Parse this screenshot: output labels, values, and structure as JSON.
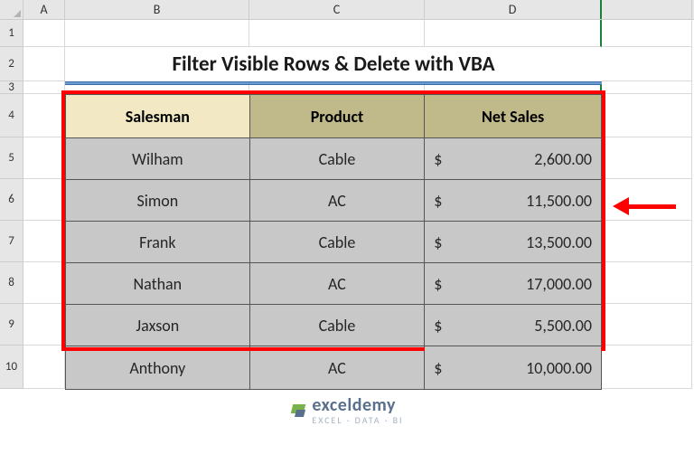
{
  "columns": {
    "A": "A",
    "B": "B",
    "C": "C",
    "D": "D"
  },
  "rows": [
    "1",
    "2",
    "3",
    "4",
    "5",
    "6",
    "7",
    "8",
    "9",
    "10"
  ],
  "title": "Filter Visible Rows & Delete with VBA",
  "chart_data": {
    "type": "table",
    "headers": [
      "Salesman",
      "Product",
      "Net Sales"
    ],
    "rows": [
      {
        "salesman": "Wilham",
        "product": "Cable",
        "net_sales": "2,600.00"
      },
      {
        "salesman": "Simon",
        "product": "AC",
        "net_sales": "11,500.00"
      },
      {
        "salesman": "Frank",
        "product": "Cable",
        "net_sales": "13,500.00"
      },
      {
        "salesman": "Nathan",
        "product": "AC",
        "net_sales": "17,000.00"
      },
      {
        "salesman": "Jaxson",
        "product": "Cable",
        "net_sales": "5,500.00"
      },
      {
        "salesman": "Anthony",
        "product": "AC",
        "net_sales": "10,000.00"
      }
    ],
    "currency_symbol": "$",
    "arrow_row_index": 2
  },
  "watermark": {
    "brand": "exceldemy",
    "sub": "EXCEL · DATA · BI"
  }
}
